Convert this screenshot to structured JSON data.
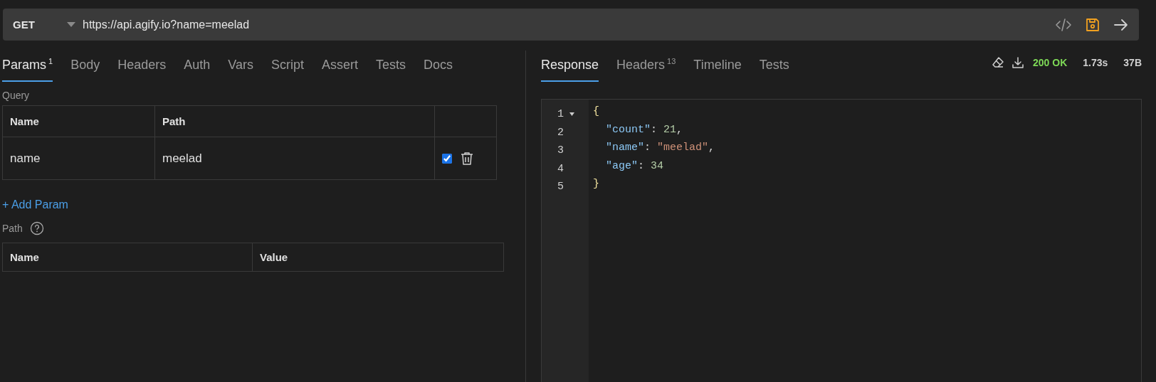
{
  "request_bar": {
    "method": "GET",
    "url": "https://api.agify.io?name=meelad"
  },
  "request_tabs": [
    {
      "label": "Params",
      "count": "1",
      "selected": true
    },
    {
      "label": "Body",
      "selected": false
    },
    {
      "label": "Headers",
      "selected": false
    },
    {
      "label": "Auth",
      "selected": false
    },
    {
      "label": "Vars",
      "selected": false
    },
    {
      "label": "Script",
      "selected": false
    },
    {
      "label": "Assert",
      "selected": false
    },
    {
      "label": "Tests",
      "selected": false
    },
    {
      "label": "Docs",
      "selected": false
    }
  ],
  "query": {
    "label": "Query",
    "columns": [
      "Name",
      "Path"
    ],
    "rows": [
      {
        "name": "name",
        "value": "meelad",
        "enabled": true
      }
    ],
    "add_link": "+ Add Param"
  },
  "path": {
    "label": "Path",
    "columns": [
      "Name",
      "Value"
    ]
  },
  "response_tabs": [
    {
      "label": "Response",
      "selected": true
    },
    {
      "label": "Headers",
      "count": "13",
      "selected": false
    },
    {
      "label": "Timeline",
      "selected": false
    },
    {
      "label": "Tests",
      "selected": false
    }
  ],
  "status": {
    "code": "200 OK",
    "time": "1.73s",
    "size": "37B"
  },
  "response_lines": [
    {
      "number": "1",
      "expanded": true,
      "tokens": [
        {
          "kind": "brace",
          "text": "{"
        }
      ]
    },
    {
      "number": "2",
      "tokens": [
        {
          "kind": "key",
          "text": "  \"count\""
        },
        {
          "kind": "punct",
          "text": ": "
        },
        {
          "kind": "number",
          "text": "21"
        },
        {
          "kind": "punct",
          "text": ","
        }
      ]
    },
    {
      "number": "3",
      "tokens": [
        {
          "kind": "key",
          "text": "  \"name\""
        },
        {
          "kind": "punct",
          "text": ": "
        },
        {
          "kind": "string",
          "text": "\"meelad\""
        },
        {
          "kind": "punct",
          "text": ","
        }
      ]
    },
    {
      "number": "4",
      "tokens": [
        {
          "kind": "key",
          "text": "  \"age\""
        },
        {
          "kind": "punct",
          "text": ": "
        },
        {
          "kind": "number",
          "text": "34"
        }
      ]
    },
    {
      "number": "5",
      "tokens": [
        {
          "kind": "brace",
          "text": "}"
        }
      ]
    }
  ]
}
